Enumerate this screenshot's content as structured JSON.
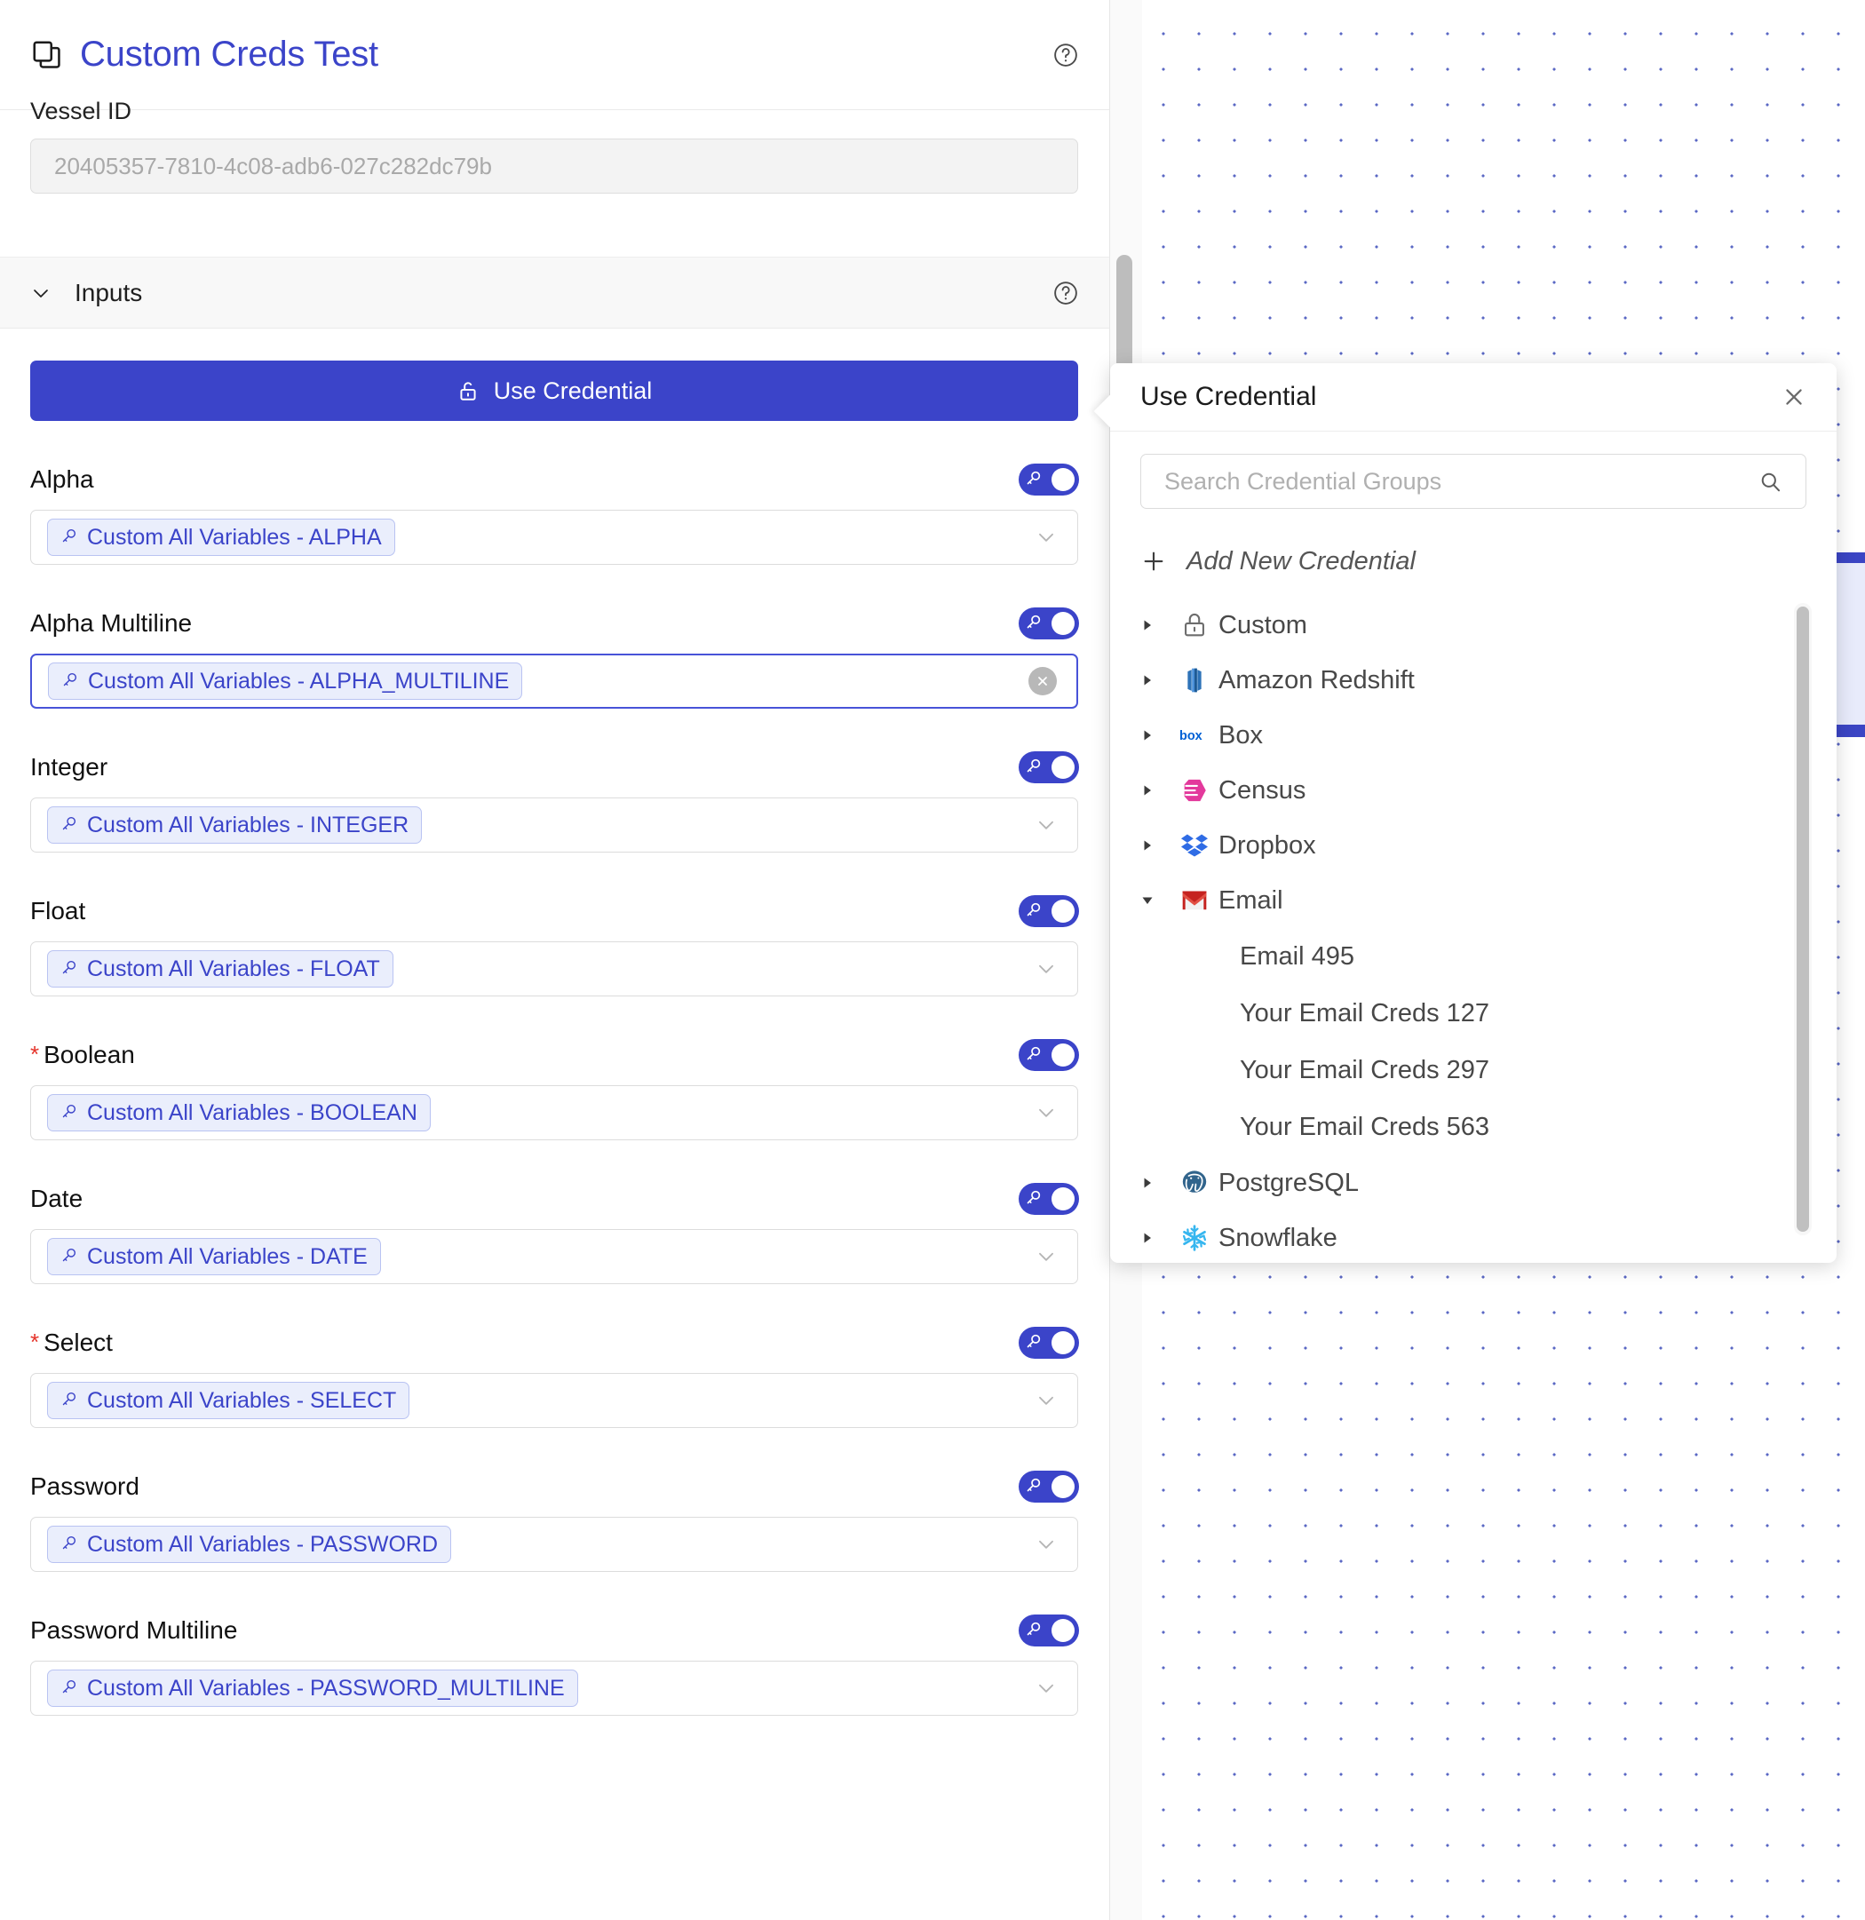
{
  "header": {
    "title": "Custom Creds Test",
    "doc_icon": "copy-document-icon",
    "help_icon": "help-circle-icon"
  },
  "vessel": {
    "label": "Vessel ID",
    "value": "20405357-7810-4c08-adb6-027c282dc79b"
  },
  "inputs_section": {
    "title": "Inputs",
    "chevron_icon": "chevron-down-icon",
    "help_icon": "help-circle-icon"
  },
  "use_credential_button": {
    "label": "Use Credential",
    "icon": "unlock-icon"
  },
  "fields": [
    {
      "label": "Alpha",
      "required": false,
      "chip": "Custom All Variables - ALPHA",
      "state": "normal",
      "toggle": true
    },
    {
      "label": "Alpha Multiline",
      "required": false,
      "chip": "Custom All Variables - ALPHA_MULTILINE",
      "state": "focused",
      "toggle": true
    },
    {
      "label": "Integer",
      "required": false,
      "chip": "Custom All Variables - INTEGER",
      "state": "normal",
      "toggle": true
    },
    {
      "label": "Float",
      "required": false,
      "chip": "Custom All Variables - FLOAT",
      "state": "normal",
      "toggle": true
    },
    {
      "label": "Boolean",
      "required": true,
      "chip": "Custom All Variables - BOOLEAN",
      "state": "normal",
      "toggle": true
    },
    {
      "label": "Date",
      "required": false,
      "chip": "Custom All Variables - DATE",
      "state": "normal",
      "toggle": true
    },
    {
      "label": "Select",
      "required": true,
      "chip": "Custom All Variables - SELECT",
      "state": "normal",
      "toggle": true
    },
    {
      "label": "Password",
      "required": false,
      "chip": "Custom All Variables - PASSWORD",
      "state": "normal",
      "toggle": true
    },
    {
      "label": "Password Multiline",
      "required": false,
      "chip": "Custom All Variables - PASSWORD_MULTILINE",
      "state": "normal",
      "toggle": true
    }
  ],
  "popover": {
    "title": "Use Credential",
    "close_icon": "close-x-icon",
    "search": {
      "placeholder": "Search Credential Groups",
      "value": "",
      "icon": "search-icon"
    },
    "add_new": {
      "label": "Add New Credential",
      "icon": "plus-icon"
    },
    "groups": [
      {
        "label": "Custom",
        "icon": "lock-icon",
        "expanded": false,
        "children": []
      },
      {
        "label": "Amazon Redshift",
        "icon": "redshift-icon",
        "expanded": false,
        "children": []
      },
      {
        "label": "Box",
        "icon": "box-icon",
        "expanded": false,
        "children": []
      },
      {
        "label": "Census",
        "icon": "census-icon",
        "expanded": false,
        "children": []
      },
      {
        "label": "Dropbox",
        "icon": "dropbox-icon",
        "expanded": false,
        "children": []
      },
      {
        "label": "Email",
        "icon": "gmail-icon",
        "expanded": true,
        "children": [
          "Email 495",
          "Your Email Creds 127",
          "Your Email Creds 297",
          "Your Email Creds 563"
        ]
      },
      {
        "label": "PostgreSQL",
        "icon": "postgresql-icon",
        "expanded": false,
        "children": []
      },
      {
        "label": "Snowflake",
        "icon": "snowflake-icon",
        "expanded": false,
        "children": []
      }
    ]
  },
  "colors": {
    "accent": "#3b44c9",
    "chip_bg": "#eaeefc",
    "chip_border": "#b9c3f2",
    "required_star": "#e5342b",
    "canvas_dot": "#5b68c4"
  }
}
